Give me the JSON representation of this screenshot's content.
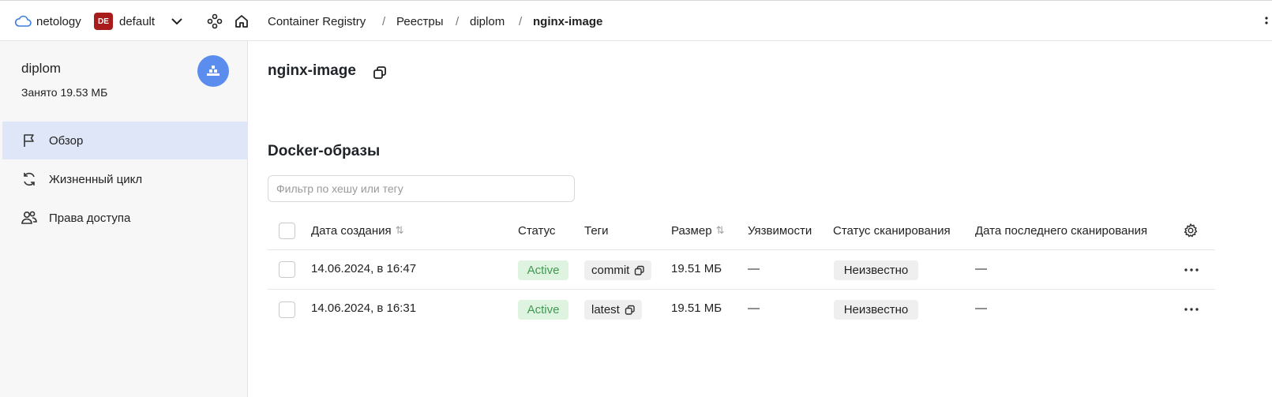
{
  "topbar": {
    "org": "netology",
    "badge": "DE",
    "folder": "default",
    "breadcrumbs": [
      "Container Registry",
      "Реестры",
      "diplom",
      "nginx-image"
    ]
  },
  "sidebar": {
    "title": "diplom",
    "used": "Занято 19.53 МБ",
    "items": [
      {
        "label": "Обзор",
        "icon": "flag-icon",
        "active": true
      },
      {
        "label": "Жизненный цикл",
        "icon": "refresh-icon",
        "active": false
      },
      {
        "label": "Права доступа",
        "icon": "users-icon",
        "active": false
      }
    ]
  },
  "main": {
    "title": "nginx-image",
    "section": "Docker-образы",
    "filter_placeholder": "Фильтр по хешу или тегу",
    "columns": [
      "Дата создания",
      "Статус",
      "Теги",
      "Размер",
      "Уязвимости",
      "Статус сканирования",
      "Дата последнего сканирования"
    ],
    "rows": [
      {
        "date": "14.06.2024, в 16:47",
        "status": "Active",
        "tag": "commit",
        "size": "19.51 МБ",
        "vulns": "—",
        "scan_status": "Неизвестно",
        "last_scan": "—"
      },
      {
        "date": "14.06.2024, в 16:31",
        "status": "Active",
        "tag": "latest",
        "size": "19.51 МБ",
        "vulns": "—",
        "scan_status": "Неизвестно",
        "last_scan": "—"
      }
    ]
  },
  "colors": {
    "accent": "#5b8def",
    "active_bg": "#dff3e1",
    "active_text": "#3e9b4f",
    "badge_bg": "#a81c1c",
    "sidebar_active": "#dfe6f7"
  }
}
